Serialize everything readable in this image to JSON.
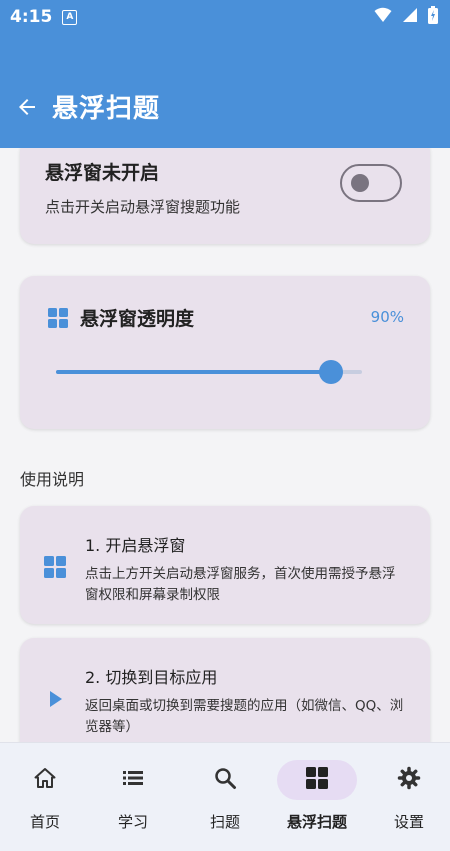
{
  "status_bar": {
    "time": "4:15",
    "notification_letter": "A",
    "icons": [
      "wifi-icon",
      "signal-icon",
      "battery-icon"
    ]
  },
  "app_bar": {
    "title": "悬浮扫题",
    "back_icon": "arrow-left-icon"
  },
  "float_toggle": {
    "title": "悬浮窗未开启",
    "description": "点击开关启动悬浮窗搜题功能",
    "enabled": false
  },
  "opacity": {
    "title": "悬浮窗透明度",
    "value_text": "90%",
    "value": 0.9,
    "icon": "grid-icon"
  },
  "instructions": {
    "title": "使用说明",
    "steps": [
      {
        "title": "1. 开启悬浮窗",
        "description": "点击上方开关启动悬浮窗服务，首次使用需授予悬浮窗权限和屏幕录制权限",
        "icon": "grid-icon"
      },
      {
        "title": "2. 切换到目标应用",
        "description": "返回桌面或切换到需要搜题的应用（如微信、QQ、浏览器等）",
        "icon": "play-icon"
      }
    ]
  },
  "bottom_nav": {
    "items": [
      {
        "label": "首页",
        "icon": "home-icon",
        "active": false
      },
      {
        "label": "学习",
        "icon": "list-icon",
        "active": false
      },
      {
        "label": "扫题",
        "icon": "search-icon",
        "active": false
      },
      {
        "label": "悬浮扫题",
        "icon": "grid-icon",
        "active": true
      },
      {
        "label": "设置",
        "icon": "gear-icon",
        "active": false
      }
    ]
  },
  "colors": {
    "primary": "#4a90d9",
    "card": "#e9e1ec",
    "nav_active": "#e6dcf3"
  }
}
